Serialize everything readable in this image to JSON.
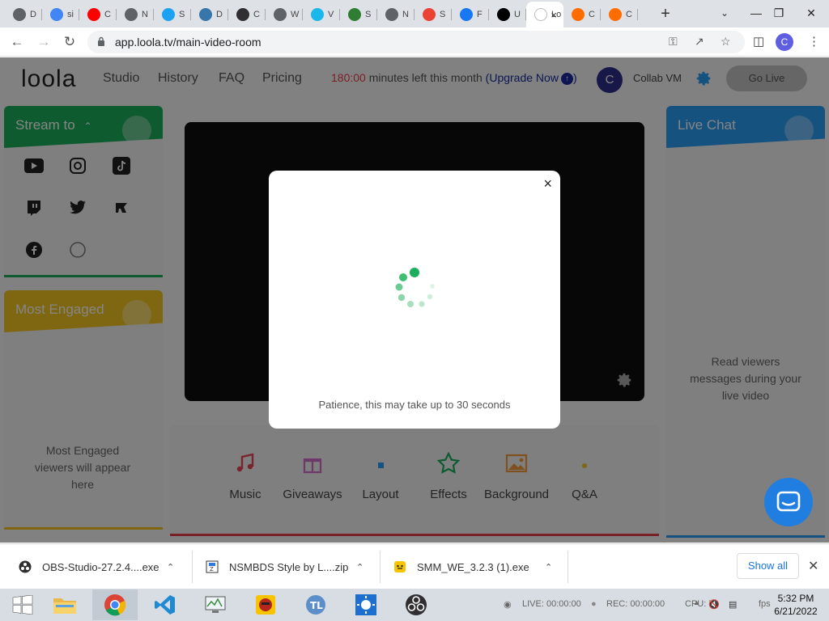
{
  "browser": {
    "tabs": [
      {
        "letter": "D",
        "favicon_color": "#5f6368"
      },
      {
        "letter": "si",
        "favicon_color": "#4285f4"
      },
      {
        "letter": "C",
        "favicon_color": "#ff0000"
      },
      {
        "letter": "N",
        "favicon_color": "#5f6368"
      },
      {
        "letter": "S",
        "favicon_color": "#1da1f2"
      },
      {
        "letter": "D",
        "favicon_color": "#3776ab"
      },
      {
        "letter": "C",
        "favicon_color": "#302e31"
      },
      {
        "letter": "W",
        "favicon_color": "#5f6368"
      },
      {
        "letter": "V",
        "favicon_color": "#1ab7ea"
      },
      {
        "letter": "S",
        "favicon_color": "#2e7d32"
      },
      {
        "letter": "N",
        "favicon_color": "#5f6368"
      },
      {
        "letter": "S",
        "favicon_color": "#ea4335"
      },
      {
        "letter": "F",
        "favicon_color": "#1877f2"
      },
      {
        "letter": "U",
        "favicon_color": "#000000"
      },
      {
        "letter": "Lo",
        "favicon_color": "#ffffff"
      },
      {
        "letter": "C",
        "favicon_color": "#ff6d00"
      },
      {
        "letter": "C",
        "favicon_color": "#ff6d00"
      }
    ],
    "active_tab_close": "×",
    "new_tab": "+",
    "url": "app.loola.tv/main-video-room",
    "profile_initial": "C"
  },
  "header": {
    "logo": "loola",
    "nav": [
      "Studio",
      "History",
      "FAQ",
      "Pricing"
    ],
    "minutes_value": "180:00",
    "minutes_text": " minutes left this month ",
    "upgrade": "(Upgrade Now",
    "upgrade_close": ")",
    "avatar_initial": "C",
    "user_name": "Collab VM",
    "go_live": "Go Live"
  },
  "left_panel": {
    "stream_to": "Stream to",
    "most_engaged": "Most Engaged",
    "engaged_placeholder": "Most Engaged viewers will appear here"
  },
  "right_panel": {
    "title": "Live Chat",
    "placeholder": "Read viewers messages during your live video"
  },
  "tools": [
    {
      "label": "Music",
      "color": "#e8445a"
    },
    {
      "label": "Giveaways",
      "color": "#d06fc9"
    },
    {
      "label": "Layout",
      "color": "#2a9df4"
    },
    {
      "label": "Effects",
      "color": "#1cae5c"
    },
    {
      "label": "Background",
      "color": "#f39c3a"
    },
    {
      "label": "Q&A",
      "color": "#f3c623"
    }
  ],
  "modal": {
    "close": "×",
    "message": "Patience, this may take up to 30 seconds"
  },
  "downloads": {
    "items": [
      "OBS-Studio-27.2.4....exe",
      "NSMBDS Style by L....zip",
      "SMM_WE_3.2.3 (1).exe"
    ],
    "show_all": "Show all"
  },
  "taskbar": {
    "live": "LIVE: 00:00:00",
    "rec": "REC: 00:00:00",
    "cpu": "CPU: 7",
    "fps": "fps",
    "time": "5:32 PM",
    "date": "6/21/2022"
  },
  "colors": {
    "brand_red": "#e83d4a",
    "stream_green": "#1cae5c",
    "engaged_yellow": "#f3c623",
    "chat_blue": "#2a9df4",
    "intercom_blue": "#1f7ee0"
  }
}
